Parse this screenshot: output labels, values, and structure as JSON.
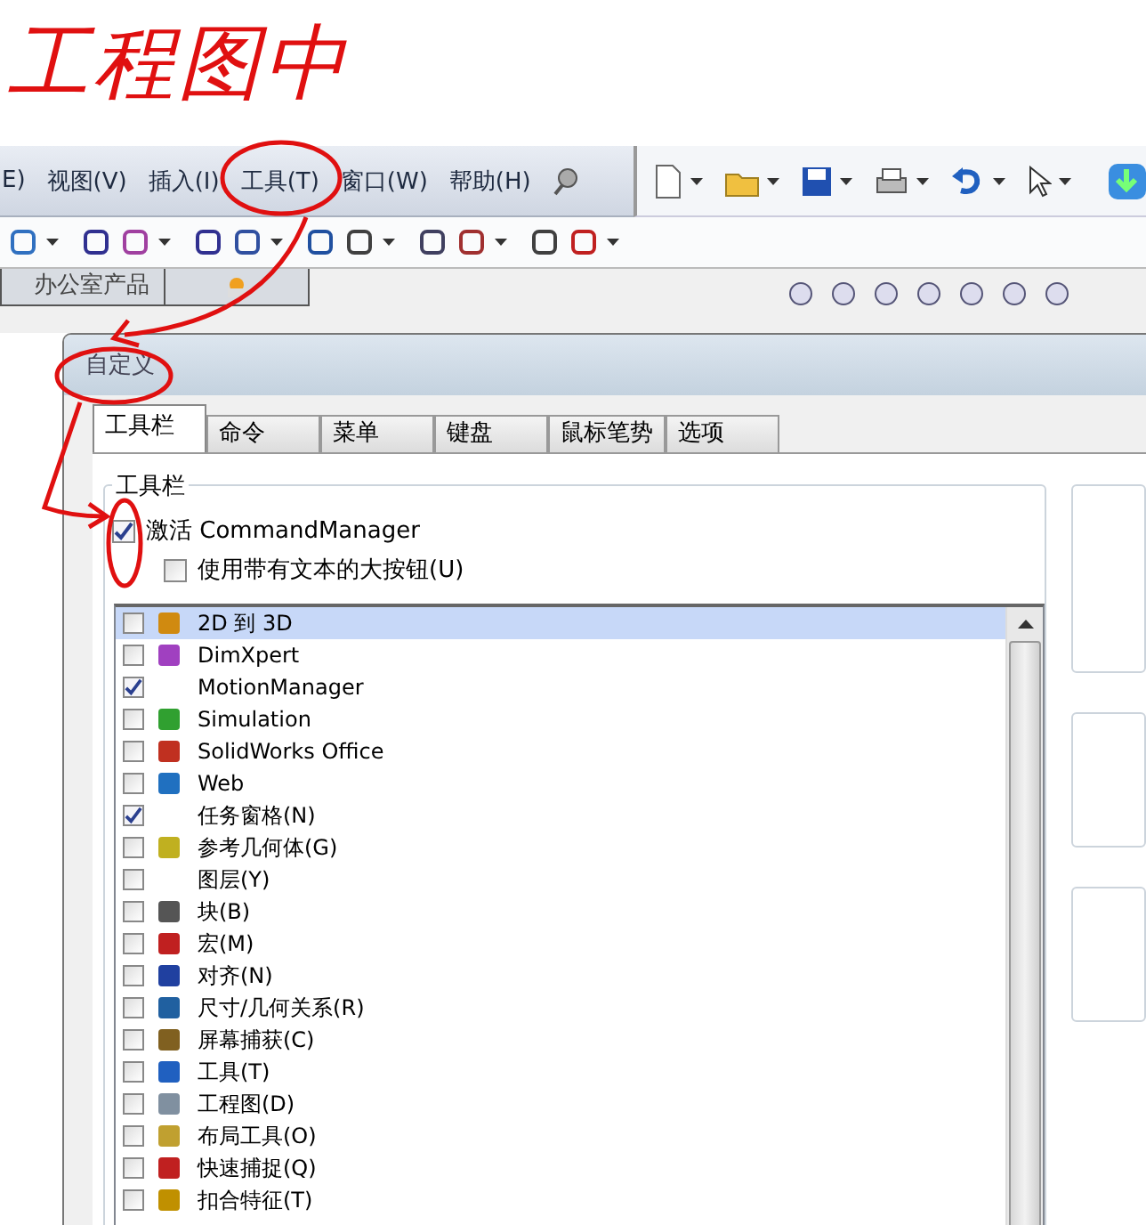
{
  "annotation": {
    "text": "工程图中"
  },
  "menu_bar": {
    "items": [
      {
        "label": "E)"
      },
      {
        "label": "视图(V)"
      },
      {
        "label": "插入(I)"
      },
      {
        "label": "工具(T)"
      },
      {
        "label": "窗口(W)"
      },
      {
        "label": "帮助(H)"
      }
    ]
  },
  "document_tabs": [
    {
      "label": "办公室产品"
    }
  ],
  "dialog": {
    "title": "自定义",
    "tabs": [
      {
        "label": "工具栏",
        "selected": true
      },
      {
        "label": "命令",
        "selected": false
      },
      {
        "label": "菜单",
        "selected": false
      },
      {
        "label": "键盘",
        "selected": false
      },
      {
        "label": "鼠标笔势",
        "selected": false
      },
      {
        "label": "选项",
        "selected": false
      }
    ],
    "group_title": "工具栏",
    "options": [
      {
        "label": "激活 CommandManager",
        "checked": true
      },
      {
        "label": "使用带有文本的大按钮(U)",
        "checked": false
      }
    ],
    "toolbars": [
      {
        "label": "2D 到 3D",
        "checked": false,
        "selected": true,
        "has_icon": true
      },
      {
        "label": "DimXpert",
        "checked": false,
        "selected": false,
        "has_icon": true
      },
      {
        "label": "MotionManager",
        "checked": true,
        "selected": false,
        "has_icon": false
      },
      {
        "label": "Simulation",
        "checked": false,
        "selected": false,
        "has_icon": true
      },
      {
        "label": "SolidWorks Office",
        "checked": false,
        "selected": false,
        "has_icon": true
      },
      {
        "label": "Web",
        "checked": false,
        "selected": false,
        "has_icon": true
      },
      {
        "label": "任务窗格(N)",
        "checked": true,
        "selected": false,
        "has_icon": false
      },
      {
        "label": "参考几何体(G)",
        "checked": false,
        "selected": false,
        "has_icon": true
      },
      {
        "label": "图层(Y)",
        "checked": false,
        "selected": false,
        "has_icon": false
      },
      {
        "label": "块(B)",
        "checked": false,
        "selected": false,
        "has_icon": true
      },
      {
        "label": "宏(M)",
        "checked": false,
        "selected": false,
        "has_icon": true
      },
      {
        "label": "对齐(N)",
        "checked": false,
        "selected": false,
        "has_icon": true
      },
      {
        "label": "尺寸/几何关系(R)",
        "checked": false,
        "selected": false,
        "has_icon": true
      },
      {
        "label": "屏幕捕获(C)",
        "checked": false,
        "selected": false,
        "has_icon": true
      },
      {
        "label": "工具(T)",
        "checked": false,
        "selected": false,
        "has_icon": true
      },
      {
        "label": "工程图(D)",
        "checked": false,
        "selected": false,
        "has_icon": true
      },
      {
        "label": "布局工具(O)",
        "checked": false,
        "selected": false,
        "has_icon": true
      },
      {
        "label": "快速捕捉(Q)",
        "checked": false,
        "selected": false,
        "has_icon": true
      },
      {
        "label": "扣合特征(T)",
        "checked": false,
        "selected": false,
        "has_icon": true
      }
    ]
  }
}
